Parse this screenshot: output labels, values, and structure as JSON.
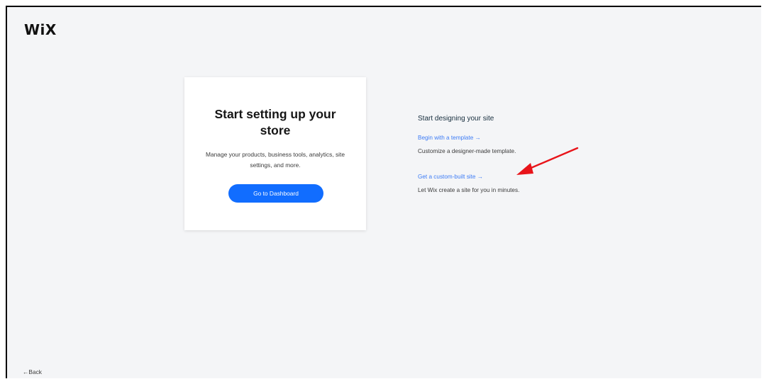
{
  "header": {
    "logo": "WiX"
  },
  "card": {
    "title": "Start setting up your store",
    "description": "Manage your products, business tools, analytics, site settings, and more.",
    "button_label": "Go to Dashboard"
  },
  "design": {
    "title": "Start designing your site",
    "options": [
      {
        "link": "Begin with a template →",
        "description": "Customize a designer-made template."
      },
      {
        "link": "Get a custom-built site →",
        "description": "Let Wix create a site for you in minutes."
      }
    ]
  },
  "footer": {
    "back_label": "←Back"
  },
  "colors": {
    "accent": "#116dff",
    "link": "#3d7cf6",
    "background": "#f4f5f7",
    "annotation_arrow": "#e8141a"
  },
  "annotation": {
    "icon": "red-arrow-icon"
  }
}
